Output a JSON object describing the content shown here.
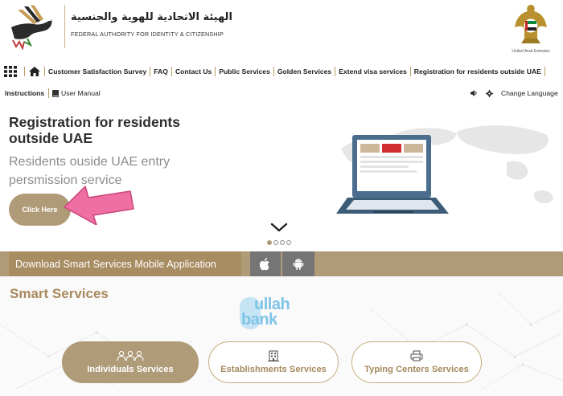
{
  "header": {
    "authority_name_ar": "الهيئة الاتحادية للهوية والجنسية",
    "authority_name_en": "FEDERAL AUTHORITY FOR IDENTITY & CITIZENSHIP",
    "emblem_caption": "United Arab Emirates"
  },
  "nav": {
    "items": [
      "Customer Satisfaction Survey",
      "FAQ",
      "Contact Us",
      "Public Services",
      "Golden Services",
      "Extend visa services",
      "Registration for residents outside UAE"
    ],
    "instructions": "Instructions",
    "user_manual": "User Manual",
    "change_language": "Change Language"
  },
  "hero": {
    "title": "Registration for residents outside UAE",
    "subtitle": "Residents ouside UAE entry persmission service",
    "button_label": "Click Here",
    "slides_total": 4,
    "slide_active": 1
  },
  "download": {
    "label": "Download Smart Services Mobile Application"
  },
  "smart_services": {
    "title": "Smart Services",
    "watermark_line1": "ullah",
    "watermark_line2": "bank",
    "cards": [
      {
        "label": "Individuals Services",
        "icon": "people-icon",
        "active": true
      },
      {
        "label": "Establishments Services",
        "icon": "building-icon",
        "active": false
      },
      {
        "label": "Typing Centers Services",
        "icon": "printer-icon",
        "active": false
      }
    ]
  },
  "colors": {
    "gold": "#b09b78",
    "gold_dark": "#a88c62",
    "title_gold": "#a7895d",
    "pink_arrow": "#f06fa3",
    "store_gray": "#757575"
  }
}
